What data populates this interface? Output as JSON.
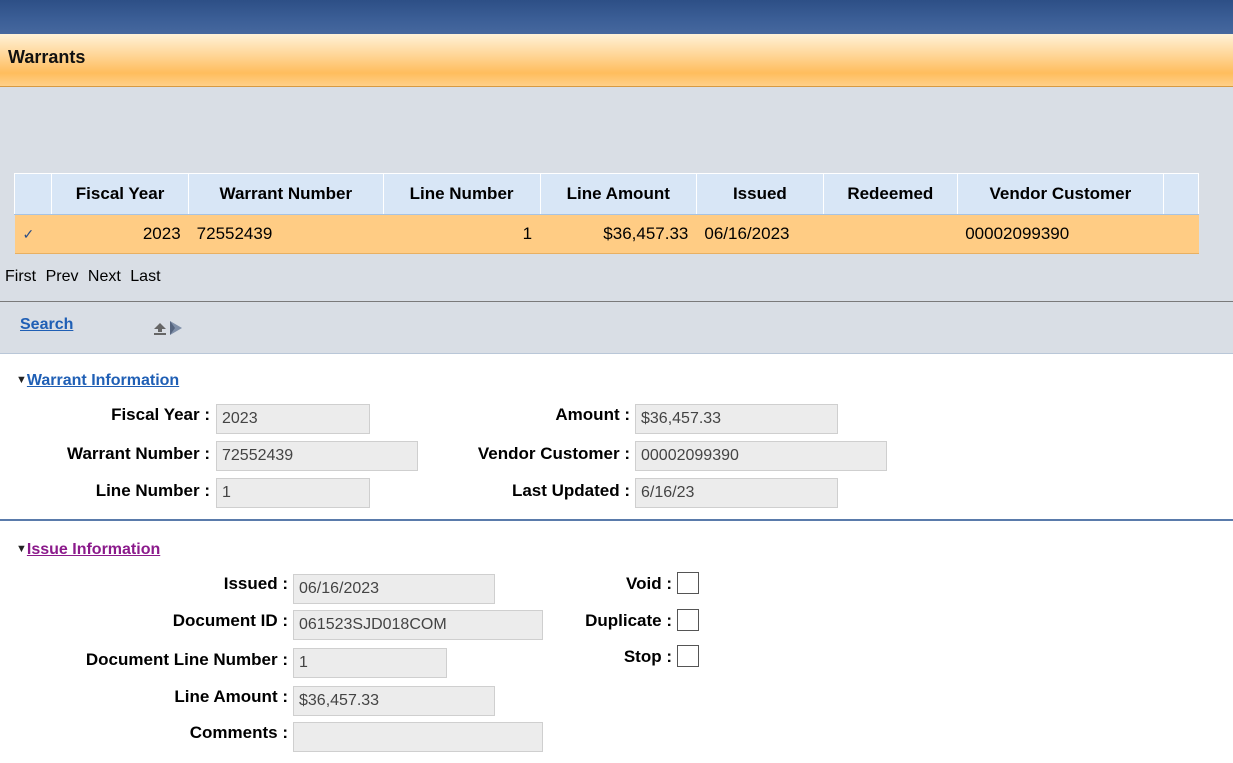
{
  "header": {
    "title": "Warrants"
  },
  "grid": {
    "columns": [
      "Fiscal Year",
      "Warrant Number",
      "Line Number",
      "Line Amount",
      "Issued",
      "Redeemed",
      "Vendor Customer"
    ],
    "row": {
      "check": "✓",
      "fiscal_year": "2023",
      "warrant_number": "72552439",
      "line_number": "1",
      "line_amount": "$36,457.33",
      "issued": "06/16/2023",
      "redeemed": "",
      "vendor_customer": "00002099390"
    }
  },
  "pager": {
    "first": "First",
    "prev": "Prev",
    "next": "Next",
    "last": "Last"
  },
  "toolbar": {
    "search_label": "Search",
    "icon": "print-export-icon"
  },
  "warrant_info": {
    "title": "Warrant Information",
    "fiscal_year_label": "Fiscal Year :",
    "fiscal_year": "2023",
    "warrant_number_label": "Warrant Number :",
    "warrant_number": "72552439",
    "line_number_label": "Line Number :",
    "line_number": "1",
    "amount_label": "Amount :",
    "amount": "$36,457.33",
    "vendor_customer_label": "Vendor Customer :",
    "vendor_customer": "00002099390",
    "last_updated_label": "Last Updated :",
    "last_updated": "6/16/23"
  },
  "issue_info": {
    "title": "Issue Information",
    "issued_label": "Issued :",
    "issued": "06/16/2023",
    "document_id_label": "Document ID :",
    "document_id": "061523SJD018COM",
    "document_line_label": "Document Line Number :",
    "document_line": "1",
    "line_amount_label": "Line Amount :",
    "line_amount": "$36,457.33",
    "comments_label": "Comments :",
    "comments": "",
    "void_label": "Void :",
    "duplicate_label": "Duplicate :",
    "stop_label": "Stop :"
  },
  "colors": {
    "link_blue": "#1f5fb5",
    "link_visited": "#8b1a8b",
    "row_selected": "#ffcc84",
    "header_blue": "#d8e6f6"
  }
}
